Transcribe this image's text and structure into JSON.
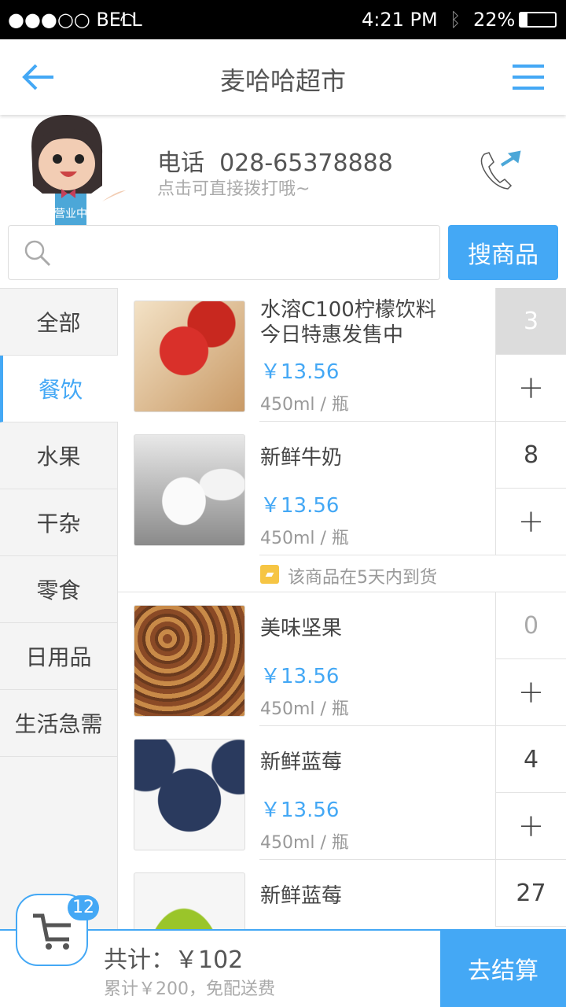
{
  "status": {
    "carrier": "●●●○○ BELL",
    "time": "4:21 PM",
    "battery": "22%"
  },
  "nav": {
    "title": "麦哈哈超市",
    "back_icon": "arrow-left-icon",
    "menu_icon": "hamburger-menu-icon"
  },
  "shop": {
    "phone_label": "电话",
    "phone": "028-65378888",
    "hint": "点击可直接拨打哦~",
    "badge_text": "营业中"
  },
  "search": {
    "placeholder": "",
    "button": "搜商品"
  },
  "categories": [
    {
      "label": "全部"
    },
    {
      "label": "餐饮",
      "active": true
    },
    {
      "label": "水果"
    },
    {
      "label": "干杂"
    },
    {
      "label": "零食"
    },
    {
      "label": "日用品"
    },
    {
      "label": "生活急需"
    }
  ],
  "products": [
    {
      "name": "水溶C100柠檬饮料\n今日特惠发售中",
      "price": "￥13.56",
      "unit": "450ml / 瓶",
      "qty": "3",
      "image": "strawberries"
    },
    {
      "name": "新鲜牛奶",
      "price": "￥13.56",
      "unit": "450ml / 瓶",
      "qty": "8",
      "image": "milk-bottles"
    },
    {
      "name": "美味坚果",
      "price": "￥13.56",
      "unit": "450ml / 瓶",
      "qty": "0",
      "image": "nuts"
    },
    {
      "name": "新鲜蓝莓",
      "price": "￥13.56",
      "unit": "450ml / 瓶",
      "qty": "4",
      "image": "blueberries"
    },
    {
      "name": "新鲜蓝莓",
      "price": "",
      "unit": "",
      "qty": "27",
      "image": "limes"
    }
  ],
  "notice": "该商品在5天内到货",
  "cart": {
    "count": "12",
    "total": "共计：￥102",
    "free_shipping": "累计￥200，免配送费",
    "checkout": "去结算"
  },
  "colors": {
    "accent": "#44a8f5",
    "qty_highlight": "#dcdcdc"
  }
}
